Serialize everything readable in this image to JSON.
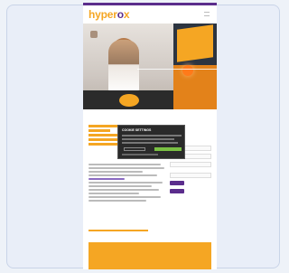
{
  "site": {
    "logo_part1": "hyper",
    "logo_part2": "o",
    "logo_part3": "x"
  },
  "colors": {
    "brand_orange": "#f5a623",
    "brand_purple": "#5b2d8c",
    "dialog_bg": "#2a2a2a",
    "accept_green": "#7ac143"
  },
  "dialog": {
    "title": "COOKIE SETTINGS"
  }
}
